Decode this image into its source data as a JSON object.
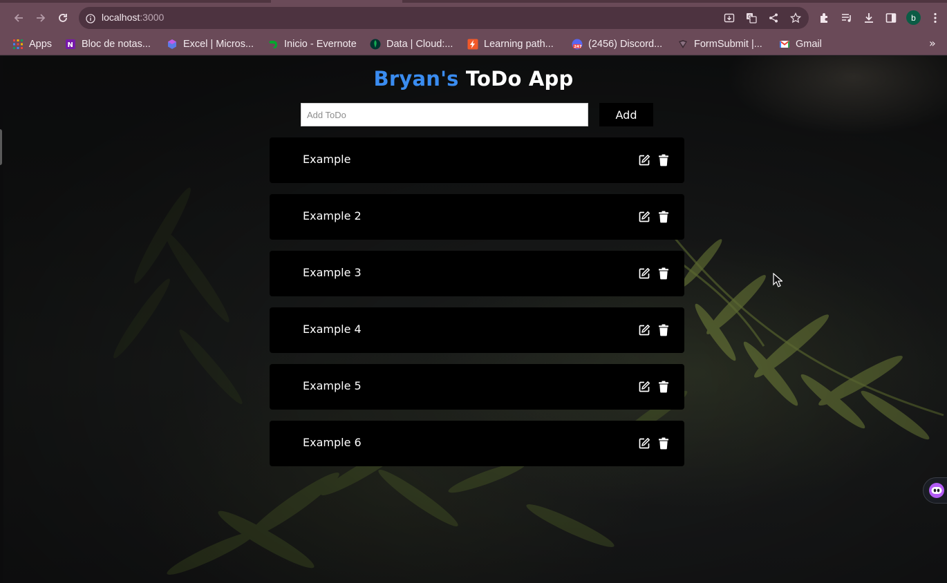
{
  "browser": {
    "url_host": "localhost",
    "url_port": ":3000",
    "profile_initial": "b",
    "toolbar_icons": [
      "back-icon",
      "forward-icon",
      "reload-icon",
      "site-info-icon",
      "install-icon",
      "translate-icon",
      "share-icon",
      "bookmark-star-icon",
      "extensions-icon",
      "media-icon",
      "downloads-icon",
      "side-panel-icon",
      "menu-icon"
    ]
  },
  "bookmarks": [
    {
      "label": "Apps",
      "icon": "apps-grid-icon"
    },
    {
      "label": "Bloc de notas...",
      "icon": "onenote-icon"
    },
    {
      "label": "Excel | Micros...",
      "icon": "excel-icon"
    },
    {
      "label": "Inicio - Evernote",
      "icon": "evernote-icon"
    },
    {
      "label": "Data | Cloud:...",
      "icon": "mongodb-leaf-icon"
    },
    {
      "label": "Learning path...",
      "icon": "learning-icon"
    },
    {
      "label": "(2456) Discord...",
      "icon": "discord-icon"
    },
    {
      "label": "FormSubmit |...",
      "icon": "formsubmit-icon"
    },
    {
      "label": "Gmail",
      "icon": "gmail-icon"
    }
  ],
  "app": {
    "title_name": "Bryan's",
    "title_rest": "ToDo App",
    "input_placeholder": "Add ToDo",
    "input_value": "",
    "add_button": "Add",
    "todos": [
      {
        "text": "Example"
      },
      {
        "text": "Example 2"
      },
      {
        "text": "Example 3"
      },
      {
        "text": "Example 4"
      },
      {
        "text": "Example 5"
      },
      {
        "text": "Example 6"
      }
    ]
  },
  "colors": {
    "accent_blue": "#3a8cf0",
    "chrome": "#6a4a58",
    "todo_background": "#000000"
  }
}
